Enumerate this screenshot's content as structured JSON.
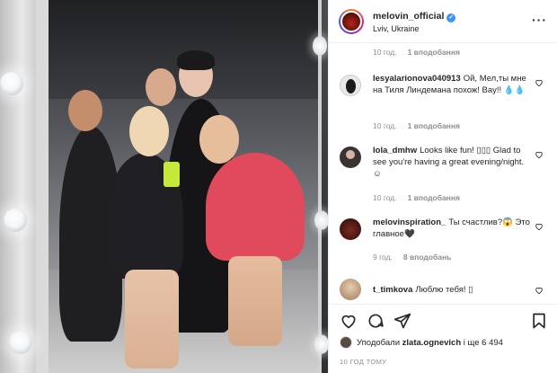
{
  "post": {
    "username": "melovin_official",
    "location": "Lviv, Ukraine",
    "more_icon": "more-horizontal-icon"
  },
  "top_meta": {
    "time": "10 год.",
    "likes": "1 вподобання"
  },
  "comments": [
    {
      "username": "lesyalarionova040913",
      "text": "Ой, Мел,ты мне на Тиля Линдемана похож! Вау!! 💧💧",
      "time": "10 год.",
      "likes": "1 вподобання",
      "avatar_color": "#e9e4df"
    },
    {
      "username": "lola_dmhw",
      "text": "Looks like fun! ▯▯▯ Glad to see you're having a great evening/night. ☺",
      "time": "10 год.",
      "likes": "1 вподобання",
      "avatar_color": "#3a3332"
    },
    {
      "username": "melovinspiration_",
      "text": "Ты счастлив?😱 Это главное🖤",
      "time": "9 год.",
      "likes": "8 вподобань",
      "avatar_color": "#3b1714"
    },
    {
      "username": "t_timkova",
      "text": "Люблю тебя! ▯",
      "avatar_color": "#c7a78a"
    }
  ],
  "liked_by": {
    "prefix": "Уподобали ",
    "user": "zlata.ognevich",
    "suffix": " і ще 6 494"
  },
  "timestamp": "10 ГОД ТОМУ",
  "colors": {
    "verified": "#3897f0",
    "muted": "#8e8e8e",
    "text": "#262626"
  }
}
